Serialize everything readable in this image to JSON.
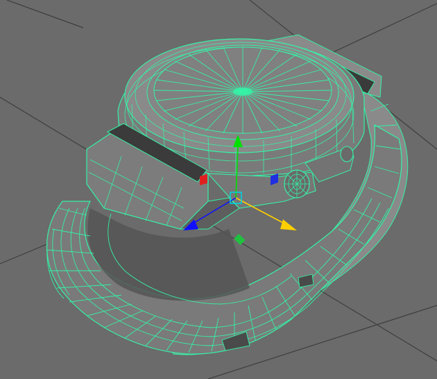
{
  "viewport": {
    "background": "#6b6b6b",
    "grid_color": "#3a3a3a",
    "wireframe_color": "#35f2a6",
    "model_fill": "#7d7d7d",
    "model_shadow": "#5a5a5a",
    "model_dark": "#3c3c3c"
  },
  "manipulator": {
    "type": "move-tool",
    "axes": [
      {
        "name": "y-axis",
        "color": "#00e000"
      },
      {
        "name": "x-axis",
        "color": "#ffd000"
      },
      {
        "name": "z-axis",
        "color": "#1010ff"
      }
    ],
    "plane_handles": [
      {
        "name": "xy-plane",
        "color": "#e02020"
      },
      {
        "name": "yz-plane",
        "color": "#2030e0"
      },
      {
        "name": "xz-plane",
        "color": "#20c040"
      }
    ],
    "center_handle_color": "#00d0e0"
  }
}
